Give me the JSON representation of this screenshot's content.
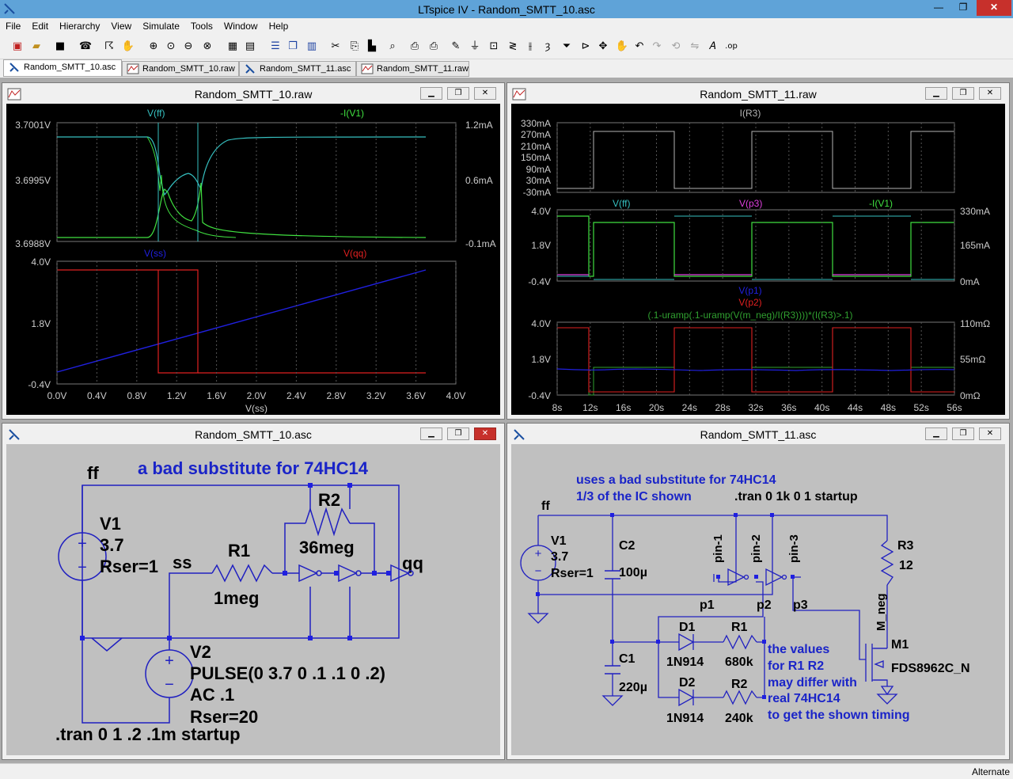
{
  "app": {
    "title": "LTspice IV - Random_SMTT_10.asc",
    "window_controls": {
      "minimize": "—",
      "restore": "❐",
      "close": "✕"
    }
  },
  "menu": [
    "File",
    "Edit",
    "Hierarchy",
    "View",
    "Simulate",
    "Tools",
    "Window",
    "Help"
  ],
  "tabs": [
    {
      "label": "Random_SMTT_10.asc",
      "kind": "schematic",
      "active": true
    },
    {
      "label": "Random_SMTT_10.raw",
      "kind": "waveform",
      "active": false
    },
    {
      "label": "Random_SMTT_11.asc",
      "kind": "schematic",
      "active": false
    },
    {
      "label": "Random_SMTT_11.raw",
      "kind": "waveform",
      "active": false
    }
  ],
  "windows": {
    "raw10": {
      "title": "Random_SMTT_10.raw"
    },
    "raw11": {
      "title": "Random_SMTT_11.raw"
    },
    "asc10": {
      "title": "Random_SMTT_10.asc"
    },
    "asc11": {
      "title": "Random_SMTT_11.asc"
    }
  },
  "plot10": {
    "pane1": {
      "traces": [
        {
          "name": "V(ff)",
          "color": "#36c0c0"
        },
        {
          "name": "-I(V1)",
          "color": "#40e040"
        }
      ],
      "left_ticks": [
        "3.7001V",
        "3.6995V",
        "3.6988V"
      ],
      "right_ticks": [
        "1.2mA",
        "0.6mA",
        "-0.1mA"
      ]
    },
    "pane2": {
      "traces": [
        {
          "name": "V(ss)",
          "color": "#2020e0"
        },
        {
          "name": "V(qq)",
          "color": "#e02020"
        }
      ],
      "left_ticks": [
        "4.0V",
        "1.8V",
        "-0.4V"
      ]
    },
    "x_ticks": [
      "0.0V",
      "0.4V",
      "0.8V",
      "1.2V",
      "1.6V",
      "2.0V",
      "2.4V",
      "2.8V",
      "3.2V",
      "3.6V",
      "4.0V"
    ],
    "x_label": "V(ss)"
  },
  "plot11": {
    "pane1": {
      "traces": [
        {
          "name": "I(R3)",
          "color": "#b4b4b4"
        }
      ],
      "left_ticks": [
        "330mA",
        "270mA",
        "210mA",
        "150mA",
        "90mA",
        "30mA",
        "-30mA"
      ]
    },
    "pane2": {
      "traces": [
        {
          "name": "V(ff)",
          "color": "#36c0c0"
        },
        {
          "name": "V(p3)",
          "color": "#e040e0"
        },
        {
          "name": "-I(V1)",
          "color": "#40e040"
        }
      ],
      "left_ticks": [
        "4.0V",
        "1.8V",
        "-0.4V"
      ],
      "right_ticks": [
        "330mA",
        "165mA",
        "0mA"
      ]
    },
    "pane3": {
      "traces": [
        {
          "name": "V(p1)",
          "color": "#2020e0"
        },
        {
          "name": "V(p2)",
          "color": "#e02020"
        },
        {
          "name": "(.1-uramp(.1-uramp(V(m_neg)/I(R3))))*(I(R3)>.1)",
          "color": "#30a030"
        }
      ],
      "left_ticks": [
        "4.0V",
        "1.8V",
        "-0.4V"
      ],
      "right_ticks": [
        "110mΩ",
        "55mΩ",
        "0mΩ"
      ]
    },
    "x_ticks": [
      "8s",
      "12s",
      "16s",
      "20s",
      "24s",
      "28s",
      "32s",
      "36s",
      "40s",
      "44s",
      "48s",
      "52s",
      "56s"
    ]
  },
  "sch10": {
    "comment": "a bad substitute for 74HC14",
    "net_ff": "ff",
    "net_ss": "ss",
    "net_qq": "qq",
    "v1": [
      "V1",
      "3.7",
      "Rser=1"
    ],
    "v2": [
      "V2",
      "PULSE(0 3.7 0 .1 .1 0 .2)",
      "AC .1",
      "Rser=20"
    ],
    "r1": [
      "R1",
      "1meg"
    ],
    "r2": [
      "R2",
      "36meg"
    ],
    "directive": ".tran 0 1 .2 .1m startup"
  },
  "sch11": {
    "comment1": "uses a bad substitute for 74HC14",
    "comment2": "1/3 of the IC shown",
    "directive": ".tran 0 1k 0 1 startup",
    "net_ff": "ff",
    "v1": [
      "V1",
      "3.7",
      "Rser=1"
    ],
    "c2": [
      "C2",
      "100µ"
    ],
    "c1": [
      "C1",
      "220µ"
    ],
    "pins": [
      "pin-1",
      "pin-2",
      "pin-3"
    ],
    "nets": [
      "p1",
      "p2",
      "p3",
      "M_neg"
    ],
    "r3": [
      "R3",
      "12"
    ],
    "d1": [
      "D1",
      "1N914"
    ],
    "d2": [
      "D2",
      "1N914"
    ],
    "r1": [
      "R1",
      "680k"
    ],
    "r2": [
      "R2",
      "240k"
    ],
    "m1": [
      "M1",
      "FDS8962C_N"
    ],
    "note": [
      "the values",
      "for R1 R2",
      "may differ with",
      "real 74HC14",
      "to get the shown timing"
    ]
  },
  "status": "Alternate"
}
